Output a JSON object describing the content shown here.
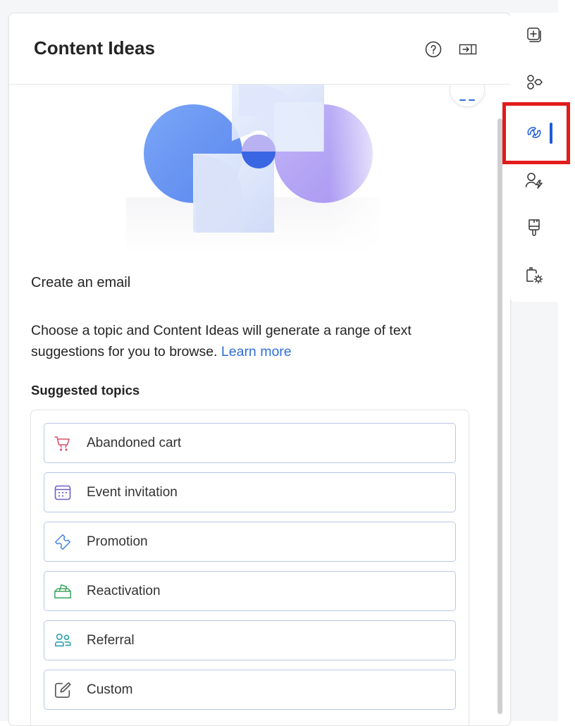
{
  "panel": {
    "title": "Content Ideas",
    "help_icon": "question-circle-icon",
    "collapse_icon": "dock-right-icon"
  },
  "hero": {
    "illustration": "copilot-swirl-illustration",
    "colors": {
      "blue": "#6e9cf5",
      "purple": "#b3a4f5",
      "pale": "#dfe6fa"
    }
  },
  "content": {
    "section_title": "Create an email",
    "description": "Choose a topic and Content Ideas will generate a range of text suggestions for you to browse.",
    "learn_more": "Learn more",
    "topics_title": "Suggested topics"
  },
  "topics": [
    {
      "label": "Abandoned cart",
      "icon": "cart-icon",
      "color": "#d9536a"
    },
    {
      "label": "Event invitation",
      "icon": "calendar-icon",
      "color": "#6c5fc7"
    },
    {
      "label": "Promotion",
      "icon": "ticket-icon",
      "color": "#3b7fe0"
    },
    {
      "label": "Reactivation",
      "icon": "ballot-box-icon",
      "color": "#3aa35b"
    },
    {
      "label": "Referral",
      "icon": "people-icon",
      "color": "#1f9aa6"
    },
    {
      "label": "Custom",
      "icon": "edit-icon",
      "color": "#555555"
    }
  ],
  "rail": {
    "items": [
      "add-section-icon",
      "elements-icon",
      "copilot-icon",
      "personalize-icon",
      "brush-icon",
      "settings-page-icon"
    ],
    "active_index": 2,
    "accent": "#1f5bd8",
    "highlight": "#e21b1b"
  }
}
